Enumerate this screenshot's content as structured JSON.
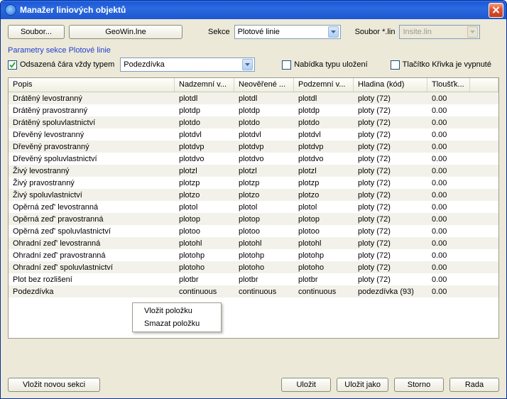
{
  "window": {
    "title": "Manažer liniových objektů"
  },
  "top": {
    "file_button": "Soubor...",
    "filename": "GeoWin.lne",
    "section_label": "Sekce",
    "section_value": "Plotové linie",
    "sourcefile_label": "Soubor *.lin",
    "sourcefile_value": "Insite.lin"
  },
  "params": {
    "heading": "Parametry sekce Plotové linie",
    "offset_label": "Odsazená čára vždy typem",
    "offset_checked": true,
    "offset_value": "Podezdívka",
    "save_type_label": "Nabídka typu uložení",
    "save_type_checked": false,
    "curve_off_label": "Tlačítko Křivka je vypnuté",
    "curve_off_checked": false
  },
  "table": {
    "headers": {
      "popis": "Popis",
      "nad": "Nadzemní v...",
      "neo": "Neověřené ...",
      "pod": "Podzemní v...",
      "hlad": "Hladina (kód)",
      "tlou": "Tloušťk..."
    },
    "rows": [
      {
        "popis": "Drátěný levostranný",
        "nad": "plotdl",
        "neo": "plotdl",
        "pod": "plotdl",
        "hlad": "ploty (72)",
        "tlou": "0.00"
      },
      {
        "popis": "Drátěný pravostranný",
        "nad": "plotdp",
        "neo": "plotdp",
        "pod": "plotdp",
        "hlad": "ploty (72)",
        "tlou": "0.00"
      },
      {
        "popis": "Drátěný spoluvlastnictví",
        "nad": "plotdo",
        "neo": "plotdo",
        "pod": "plotdo",
        "hlad": "ploty (72)",
        "tlou": "0.00"
      },
      {
        "popis": "Dřevěný levostranný",
        "nad": "plotdvl",
        "neo": "plotdvl",
        "pod": "plotdvl",
        "hlad": "ploty (72)",
        "tlou": "0.00"
      },
      {
        "popis": "Dřevěný pravostranný",
        "nad": "plotdvp",
        "neo": "plotdvp",
        "pod": "plotdvp",
        "hlad": "ploty (72)",
        "tlou": "0.00"
      },
      {
        "popis": "Dřevěný spoluvlastnictví",
        "nad": "plotdvo",
        "neo": "plotdvo",
        "pod": "plotdvo",
        "hlad": "ploty (72)",
        "tlou": "0.00"
      },
      {
        "popis": "Živý levostranný",
        "nad": "plotzl",
        "neo": "plotzl",
        "pod": "plotzl",
        "hlad": "ploty (72)",
        "tlou": "0.00"
      },
      {
        "popis": "Živý pravostranný",
        "nad": "plotzp",
        "neo": "plotzp",
        "pod": "plotzp",
        "hlad": "ploty (72)",
        "tlou": "0.00"
      },
      {
        "popis": "Živý spoluvlastnictví",
        "nad": "plotzo",
        "neo": "plotzo",
        "pod": "plotzo",
        "hlad": "ploty (72)",
        "tlou": "0.00"
      },
      {
        "popis": "Opěrná zeď' levostranná",
        "nad": "plotol",
        "neo": "plotol",
        "pod": "plotol",
        "hlad": "ploty (72)",
        "tlou": "0.00"
      },
      {
        "popis": "Opěrná zeď' pravostranná",
        "nad": "plotop",
        "neo": "plotop",
        "pod": "plotop",
        "hlad": "ploty (72)",
        "tlou": "0.00"
      },
      {
        "popis": "Opěrná zeď' spoluvlastnictví",
        "nad": "plotoo",
        "neo": "plotoo",
        "pod": "plotoo",
        "hlad": "ploty (72)",
        "tlou": "0.00"
      },
      {
        "popis": "Ohradní zeď' levostranná",
        "nad": "plotohl",
        "neo": "plotohl",
        "pod": "plotohl",
        "hlad": "ploty (72)",
        "tlou": "0.00"
      },
      {
        "popis": "Ohradní zeď' pravostranná",
        "nad": "plotohp",
        "neo": "plotohp",
        "pod": "plotohp",
        "hlad": "ploty (72)",
        "tlou": "0.00"
      },
      {
        "popis": "Ohradní zeď' spoluvlastnictví",
        "nad": "plotoho",
        "neo": "plotoho",
        "pod": "plotoho",
        "hlad": "ploty (72)",
        "tlou": "0.00"
      },
      {
        "popis": "Plot bez rozlišení",
        "nad": "plotbr",
        "neo": "plotbr",
        "pod": "plotbr",
        "hlad": "ploty (72)",
        "tlou": "0.00"
      },
      {
        "popis": "Podezdívka",
        "nad": "continuous",
        "neo": "continuous",
        "pod": "continuous",
        "hlad": "podezdívka (93)",
        "tlou": "0.00"
      }
    ]
  },
  "context_menu": {
    "insert": "Vložit položku",
    "delete": "Smazat položku"
  },
  "buttons": {
    "new_section": "Vložit novou sekci",
    "save": "Uložit",
    "save_as": "Uložit jako",
    "cancel": "Storno",
    "help": "Rada"
  }
}
